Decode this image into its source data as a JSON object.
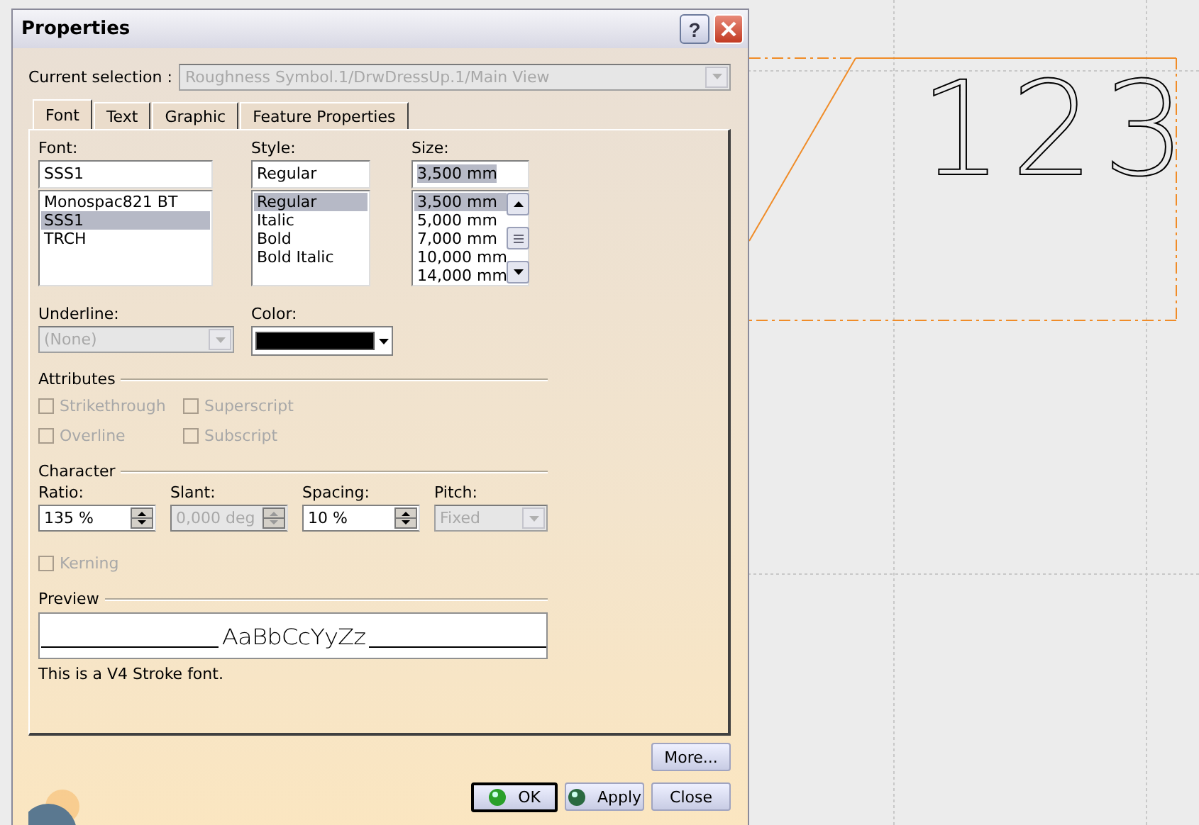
{
  "window": {
    "title": "Properties",
    "help": "?"
  },
  "current_selection": {
    "label": "Current selection :",
    "value": "Roughness Symbol.1/DrwDressUp.1/Main View",
    "disabled": true
  },
  "tabs": [
    {
      "label": "Font",
      "selected": true
    },
    {
      "label": "Text",
      "selected": false
    },
    {
      "label": "Graphic",
      "selected": false
    },
    {
      "label": "Feature Properties",
      "selected": false
    }
  ],
  "lists": [
    {
      "label": "Font:",
      "value": "SSS1",
      "scroll": false,
      "options": [
        {
          "label": "Monospac821 BT",
          "selected": false
        },
        {
          "label": "SSS1",
          "selected": true
        },
        {
          "label": "TRCH",
          "selected": false
        }
      ]
    },
    {
      "label": "Style:",
      "value": "Regular",
      "scroll": false,
      "options": [
        {
          "label": "Regular",
          "selected": true
        },
        {
          "label": "Italic",
          "selected": false
        },
        {
          "label": "Bold",
          "selected": false
        },
        {
          "label": "Bold Italic",
          "selected": false
        }
      ]
    },
    {
      "label": "Size:",
      "value": "3,500 mm",
      "scroll": true,
      "options": [
        {
          "label": "3,500 mm",
          "selected": true
        },
        {
          "label": "5,000 mm",
          "selected": false
        },
        {
          "label": "7,000 mm",
          "selected": false
        },
        {
          "label": "10,000 mm",
          "selected": false
        },
        {
          "label": "14,000 mm",
          "selected": false
        }
      ]
    }
  ],
  "underline": {
    "label": "Underline:",
    "value": "(None)",
    "disabled": true
  },
  "color": {
    "label": "Color:"
  },
  "attributes": {
    "title": "Attributes",
    "options": [
      {
        "label": "Strikethrough",
        "checked": false,
        "disabled": true
      },
      {
        "label": "Superscript",
        "checked": false,
        "disabled": true
      },
      {
        "label": "Overline",
        "checked": false,
        "disabled": true
      },
      {
        "label": "Subscript",
        "checked": false,
        "disabled": true
      }
    ]
  },
  "character": {
    "title": "Character",
    "fields": [
      {
        "label": "Ratio:",
        "value": "135 %",
        "kind": "spin",
        "disabled": false
      },
      {
        "label": "Slant:",
        "value": "0,000 deg",
        "kind": "spin",
        "disabled": true
      },
      {
        "label": "Spacing:",
        "value": "10 %",
        "kind": "spin",
        "disabled": false
      },
      {
        "label": "Pitch:",
        "value": "Fixed",
        "kind": "combo",
        "disabled": true
      }
    ]
  },
  "kerning": {
    "label": "Kerning",
    "checked": false,
    "disabled": true
  },
  "preview": {
    "title": "Preview",
    "sample": "AaBbCcYyZz",
    "note": "This is a V4 Stroke font."
  },
  "buttons": [
    {
      "label": "More...",
      "kind": "plain",
      "default": false
    },
    {
      "label": "OK",
      "kind": "green",
      "default": true
    },
    {
      "label": "Apply",
      "kind": "dark",
      "default": false
    },
    {
      "label": "Close",
      "kind": "plain",
      "default": false
    }
  ],
  "canvas": {
    "annotation": "123"
  }
}
